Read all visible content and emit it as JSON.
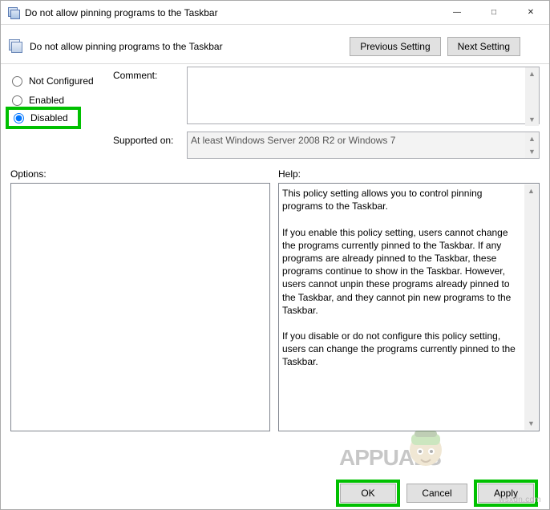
{
  "window": {
    "title": "Do not allow pinning programs to the Taskbar"
  },
  "subheader": {
    "title": "Do not allow pinning programs to the Taskbar"
  },
  "nav": {
    "previous": "Previous Setting",
    "next": "Next Setting"
  },
  "radios": {
    "not_configured": "Not Configured",
    "enabled": "Enabled",
    "disabled": "Disabled",
    "selected": "disabled"
  },
  "fields": {
    "comment_label": "Comment:",
    "comment_value": "",
    "supported_label": "Supported on:",
    "supported_value": "At least Windows Server 2008 R2 or Windows 7"
  },
  "lower": {
    "options_label": "Options:",
    "help_label": "Help:",
    "help_text": "This policy setting allows you to control pinning programs to the Taskbar.\n\nIf you enable this policy setting, users cannot change the programs currently pinned to the Taskbar. If any programs are already pinned to the Taskbar, these programs continue to show in the Taskbar. However, users cannot unpin these programs already pinned to the Taskbar, and they cannot pin new programs to the Taskbar.\n\nIf you disable or do not configure this policy setting, users can change the programs currently pinned to the Taskbar."
  },
  "footer": {
    "ok": "OK",
    "cancel": "Cancel",
    "apply": "Apply"
  },
  "watermark": {
    "brand": "APPUALS",
    "site": "wsxdn.com"
  }
}
